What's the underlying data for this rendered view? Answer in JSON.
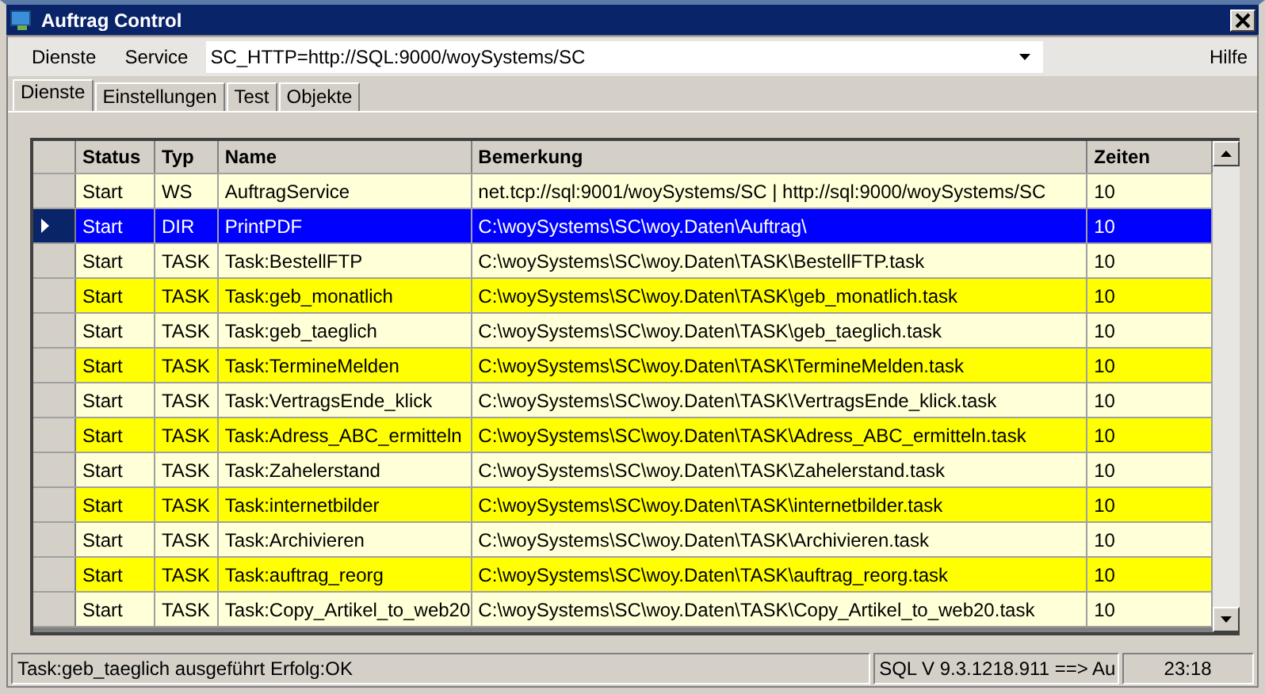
{
  "window": {
    "title": "Auftrag Control"
  },
  "menu": [
    {
      "label": "Dienste"
    },
    {
      "label": "Service"
    }
  ],
  "service_combo": {
    "value": "SC_HTTP=http://SQL:9000/woySystems/SC"
  },
  "help_menu": {
    "label": "Hilfe"
  },
  "tabs": [
    {
      "label": "Dienste",
      "selected": true
    },
    {
      "label": "Einstellungen",
      "selected": false
    },
    {
      "label": "Test",
      "selected": false
    },
    {
      "label": "Objekte",
      "selected": false
    }
  ],
  "table": {
    "columns": [
      "Status",
      "Typ",
      "Name",
      "Bemerkung",
      "Zeiten"
    ],
    "rows": [
      {
        "cells": [
          "Start",
          "WS",
          "AuftragService",
          "net.tcp://sql:9001/woySystems/SC | http://sql:9000/woySystems/SC",
          "10"
        ],
        "selected": false,
        "color": "#ffffd8"
      },
      {
        "cells": [
          "Start",
          "DIR",
          "PrintPDF",
          "C:\\woySystems\\SC\\woy.Daten\\Auftrag\\",
          "10"
        ],
        "selected": true,
        "color": "#0000ff"
      },
      {
        "cells": [
          "Start",
          "TASK",
          "Task:BestellFTP",
          "C:\\woySystems\\SC\\woy.Daten\\TASK\\BestellFTP.task",
          "10"
        ],
        "selected": false,
        "color": "#ffffd8"
      },
      {
        "cells": [
          "Start",
          "TASK",
          "Task:geb_monatlich",
          "C:\\woySystems\\SC\\woy.Daten\\TASK\\geb_monatlich.task",
          "10"
        ],
        "selected": false,
        "color": "#ffff00"
      },
      {
        "cells": [
          "Start",
          "TASK",
          "Task:geb_taeglich",
          "C:\\woySystems\\SC\\woy.Daten\\TASK\\geb_taeglich.task",
          "10"
        ],
        "selected": false,
        "color": "#ffffd8"
      },
      {
        "cells": [
          "Start",
          "TASK",
          "Task:TermineMelden",
          "C:\\woySystems\\SC\\woy.Daten\\TASK\\TermineMelden.task",
          "10"
        ],
        "selected": false,
        "color": "#ffff00"
      },
      {
        "cells": [
          "Start",
          "TASK",
          "Task:VertragsEnde_klick",
          "C:\\woySystems\\SC\\woy.Daten\\TASK\\VertragsEnde_klick.task",
          "10"
        ],
        "selected": false,
        "color": "#ffffd8"
      },
      {
        "cells": [
          "Start",
          "TASK",
          "Task:Adress_ABC_ermitteln",
          "C:\\woySystems\\SC\\woy.Daten\\TASK\\Adress_ABC_ermitteln.task",
          "10"
        ],
        "selected": false,
        "color": "#ffff00"
      },
      {
        "cells": [
          "Start",
          "TASK",
          "Task:Zahelerstand",
          "C:\\woySystems\\SC\\woy.Daten\\TASK\\Zahelerstand.task",
          "10"
        ],
        "selected": false,
        "color": "#ffffd8"
      },
      {
        "cells": [
          "Start",
          "TASK",
          "Task:internetbilder",
          "C:\\woySystems\\SC\\woy.Daten\\TASK\\internetbilder.task",
          "10"
        ],
        "selected": false,
        "color": "#ffff00"
      },
      {
        "cells": [
          "Start",
          "TASK",
          "Task:Archivieren",
          "C:\\woySystems\\SC\\woy.Daten\\TASK\\Archivieren.task",
          "10"
        ],
        "selected": false,
        "color": "#ffffd8"
      },
      {
        "cells": [
          "Start",
          "TASK",
          "Task:auftrag_reorg",
          "C:\\woySystems\\SC\\woy.Daten\\TASK\\auftrag_reorg.task",
          "10"
        ],
        "selected": false,
        "color": "#ffff00"
      },
      {
        "cells": [
          "Start",
          "TASK",
          "Task:Copy_Artikel_to_web20",
          "C:\\woySystems\\SC\\woy.Daten\\TASK\\Copy_Artikel_to_web20.task",
          "10"
        ],
        "selected": false,
        "color": "#ffffd8"
      }
    ]
  },
  "status_bar": {
    "message": "Task:geb_taeglich ausgeführt Erfolg:OK",
    "version": "SQL   V 9.3.1218.911 ==> Au",
    "time": "23:18"
  }
}
